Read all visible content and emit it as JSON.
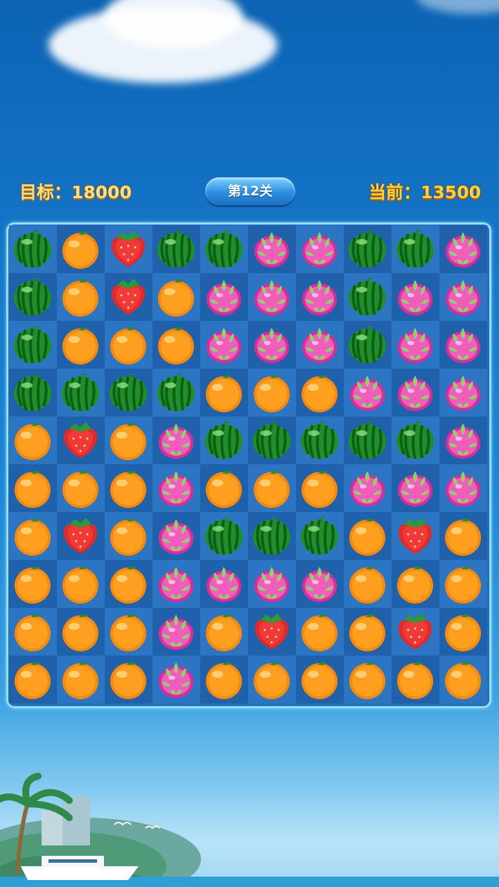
{
  "hud": {
    "target_label": "目标：18000",
    "level_label": "第12关",
    "current_label": "当前：13500"
  },
  "board": {
    "columns": 10,
    "rows": 10,
    "legend": {
      "W": "watermelon",
      "O": "orange",
      "S": "strawberry",
      "D": "dragonfruit"
    },
    "grid": [
      [
        "W",
        "O",
        "S",
        "W",
        "W",
        "D",
        "D",
        "W",
        "W",
        "D"
      ],
      [
        "W",
        "O",
        "S",
        "O",
        "D",
        "D",
        "D",
        "W",
        "D",
        "D"
      ],
      [
        "W",
        "O",
        "O",
        "O",
        "D",
        "D",
        "D",
        "W",
        "D",
        "D"
      ],
      [
        "W",
        "W",
        "W",
        "W",
        "O",
        "O",
        "O",
        "D",
        "D",
        "D"
      ],
      [
        "O",
        "S",
        "O",
        "D",
        "W",
        "W",
        "W",
        "W",
        "W",
        "D"
      ],
      [
        "O",
        "O",
        "O",
        "D",
        "O",
        "O",
        "O",
        "D",
        "D",
        "D"
      ],
      [
        "O",
        "S",
        "O",
        "D",
        "W",
        "W",
        "W",
        "O",
        "S",
        "O"
      ],
      [
        "O",
        "O",
        "O",
        "D",
        "D",
        "D",
        "D",
        "O",
        "O",
        "O"
      ],
      [
        "O",
        "O",
        "O",
        "D",
        "O",
        "S",
        "O",
        "O",
        "S",
        "O"
      ],
      [
        "O",
        "O",
        "O",
        "D",
        "O",
        "O",
        "O",
        "O",
        "O",
        "O"
      ]
    ]
  }
}
